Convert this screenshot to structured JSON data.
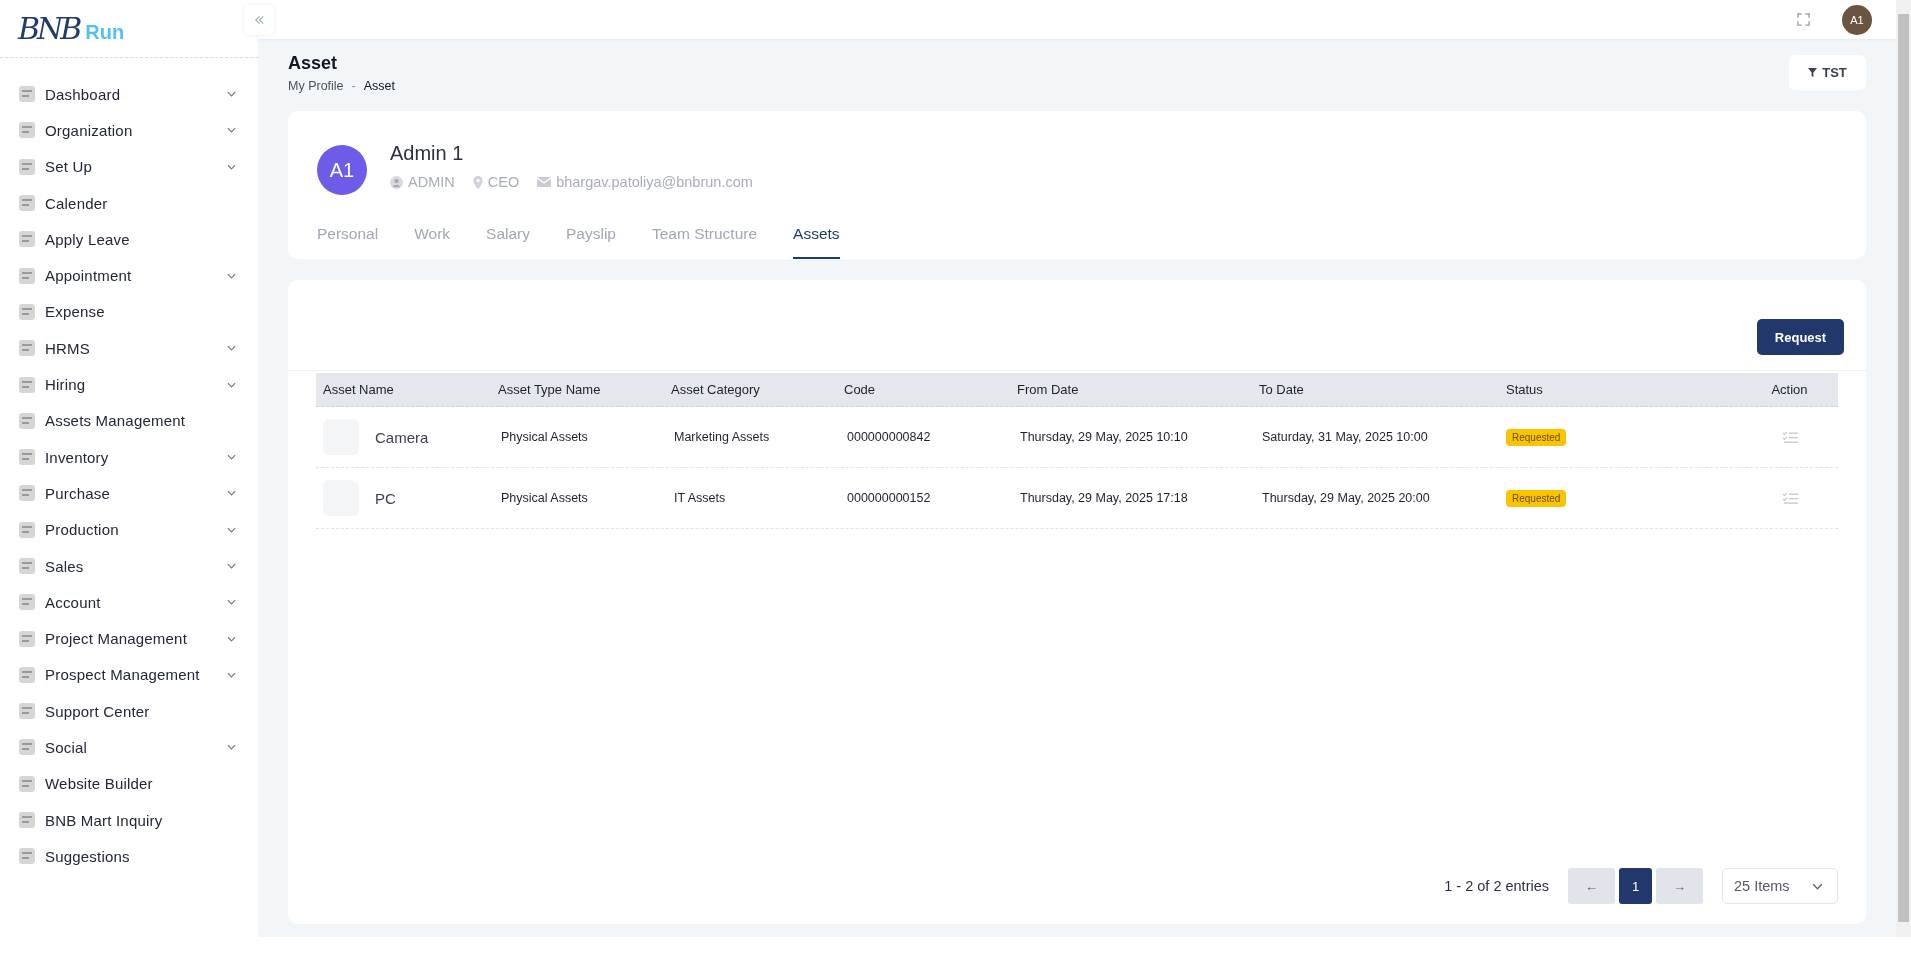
{
  "logo": {
    "mark": "BNB",
    "text": "Run"
  },
  "sidebar": {
    "items": [
      {
        "label": "Dashboard",
        "has_submenu": true
      },
      {
        "label": "Organization",
        "has_submenu": true
      },
      {
        "label": "Set Up",
        "has_submenu": true
      },
      {
        "label": "Calender",
        "has_submenu": false
      },
      {
        "label": "Apply Leave",
        "has_submenu": false
      },
      {
        "label": "Appointment",
        "has_submenu": true
      },
      {
        "label": "Expense",
        "has_submenu": false
      },
      {
        "label": "HRMS",
        "has_submenu": true
      },
      {
        "label": "Hiring",
        "has_submenu": true
      },
      {
        "label": "Assets Management",
        "has_submenu": false
      },
      {
        "label": "Inventory",
        "has_submenu": true
      },
      {
        "label": "Purchase",
        "has_submenu": true
      },
      {
        "label": "Production",
        "has_submenu": true
      },
      {
        "label": "Sales",
        "has_submenu": true
      },
      {
        "label": "Account",
        "has_submenu": true
      },
      {
        "label": "Project Management",
        "has_submenu": true
      },
      {
        "label": "Prospect Management",
        "has_submenu": true
      },
      {
        "label": "Support Center",
        "has_submenu": false
      },
      {
        "label": "Social",
        "has_submenu": true
      },
      {
        "label": "Website Builder",
        "has_submenu": false
      },
      {
        "label": "BNB Mart Inquiry",
        "has_submenu": false
      },
      {
        "label": "Suggestions",
        "has_submenu": false
      }
    ]
  },
  "topbar": {
    "avatar": "A1"
  },
  "page": {
    "title": "Asset",
    "breadcrumb": [
      "My Profile",
      "Asset"
    ],
    "breadcrumb_separator": "-",
    "filter_button": "TST"
  },
  "profile": {
    "avatar": "A1",
    "name": "Admin 1",
    "role": "ADMIN",
    "designation": "CEO",
    "email": "bhargav.patoliya@bnbrun.com",
    "tabs": [
      {
        "label": "Personal",
        "selected": false
      },
      {
        "label": "Work",
        "selected": false
      },
      {
        "label": "Salary",
        "selected": false
      },
      {
        "label": "Payslip",
        "selected": false
      },
      {
        "label": "Team Structure",
        "selected": false
      },
      {
        "label": "Assets",
        "selected": true
      }
    ]
  },
  "assets": {
    "request_button": "Request",
    "table": {
      "columns": [
        "Asset Name",
        "Asset Type Name",
        "Asset Category",
        "Code",
        "From Date",
        "To Date",
        "Status",
        "Action"
      ],
      "rows": [
        {
          "name": "Camera",
          "type": "Physical Assets",
          "category": "Marketing Assets",
          "code": "000000000842",
          "from": "Thursday, 29 May, 2025 10:10",
          "to": "Saturday, 31 May, 2025 10:00",
          "status": "Requested"
        },
        {
          "name": "PC",
          "type": "Physical Assets",
          "category": "IT Assets",
          "code": "000000000152",
          "from": "Thursday, 29 May, 2025 17:18",
          "to": "Thursday, 29 May, 2025 20:00",
          "status": "Requested"
        }
      ]
    },
    "pagination": {
      "summary": "1 - 2 of 2 entries",
      "prev": "←",
      "next": "→",
      "pages": [
        {
          "label": "1",
          "selected": true
        }
      ],
      "per_page": "25 Items"
    }
  }
}
